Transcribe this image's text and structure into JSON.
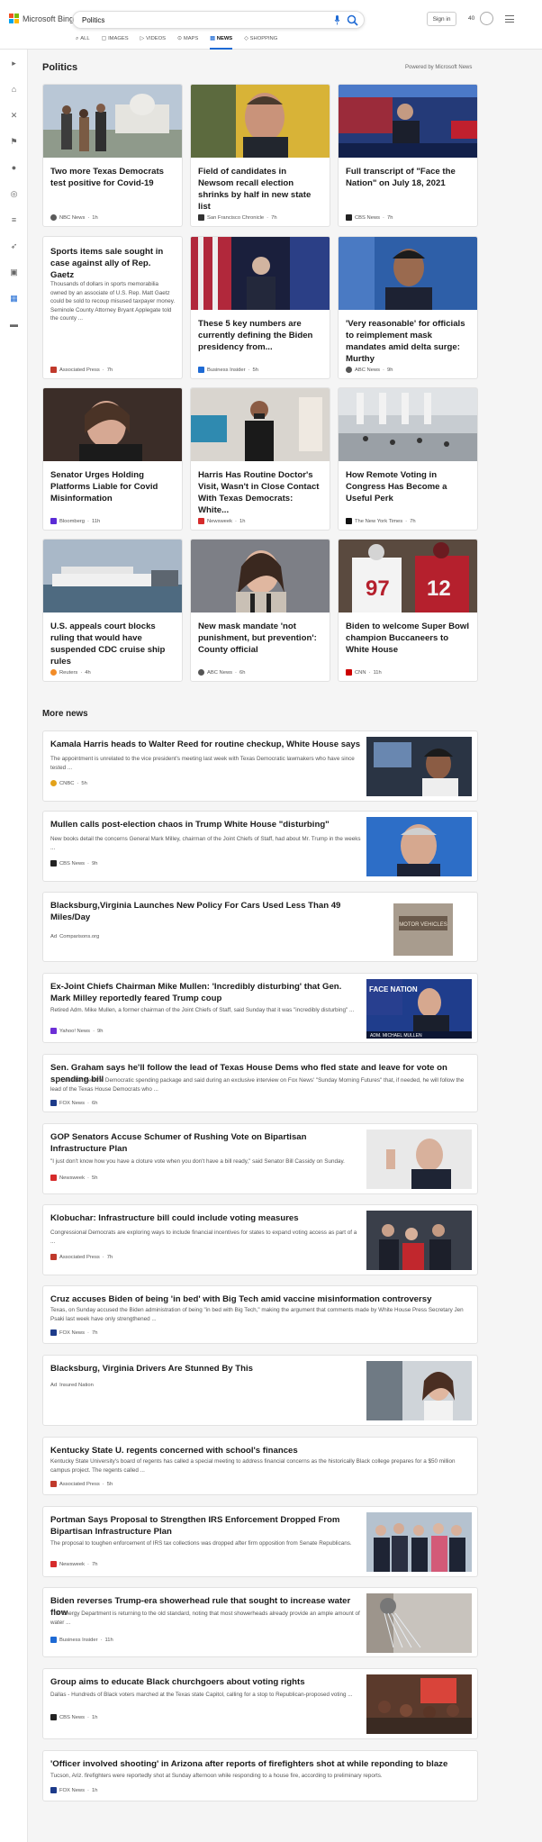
{
  "header": {
    "logo_text": "Microsoft Bing",
    "search_value": "Politics",
    "sign_in": "Sign in",
    "points": "40",
    "tabs": [
      {
        "label": "ALL",
        "icon": "search-icon"
      },
      {
        "label": "IMAGES",
        "icon": "image-icon"
      },
      {
        "label": "VIDEOS",
        "icon": "video-icon"
      },
      {
        "label": "MAPS",
        "icon": "map-pin-icon"
      },
      {
        "label": "NEWS",
        "icon": "news-icon",
        "active": true
      },
      {
        "label": "SHOPPING",
        "icon": "tag-icon"
      }
    ]
  },
  "section": {
    "title": "Politics",
    "powered": "Powered by Microsoft News"
  },
  "colors": {
    "accent": "#1e6ad4"
  },
  "cards": [
    {
      "title": "Two more Texas Democrats test positive for Covid-19",
      "source": "NBC News",
      "time": "1h",
      "badge": "#5a5a5a"
    },
    {
      "title": "Field of candidates in Newsom recall election shrinks by half in new state list",
      "source": "San Francisco Chronicle",
      "time": "7h",
      "badge": "#333333"
    },
    {
      "title": "Full transcript of \"Face the Nation\" on July 18, 2021",
      "source": "CBS News",
      "time": "7h",
      "badge": "#222222"
    },
    {
      "title": "Sports items sale sought in case against ally of Rep. Gaetz",
      "snippet": "Thousands of dollars in sports memorabilia owned by an associate of U.S. Rep. Matt Gaetz could be sold to recoup misused taxpayer money. Seminole County Attorney Bryant Applegate told the county ...",
      "source": "Associated Press",
      "time": "7h",
      "badge": "#c0392b"
    },
    {
      "title": "These 5 key numbers are currently defining the Biden presidency from...",
      "source": "Business Insider",
      "time": "5h",
      "badge": "#1e6ad4"
    },
    {
      "title": "'Very reasonable' for officials to reimplement mask mandates amid delta surge: Murthy",
      "source": "ABC News",
      "time": "9h",
      "badge": "#555555"
    },
    {
      "title": "Senator Urges Holding Platforms Liable for Covid Misinformation",
      "source": "Bloomberg",
      "time": "11h",
      "badge": "#5b2bd6"
    },
    {
      "title": "Harris Has Routine Doctor's Visit, Wasn't in Close Contact With Texas Democrats: White...",
      "source": "Newsweek",
      "time": "1h",
      "badge": "#d62b2b"
    },
    {
      "title": "How Remote Voting in Congress Has Become a Useful Perk",
      "source": "The New York Times",
      "time": "7h",
      "badge": "#111111"
    },
    {
      "title": "U.S. appeals court blocks ruling that would have suspended CDC cruise ship rules",
      "source": "Reuters",
      "time": "4h",
      "badge": "#f28c28"
    },
    {
      "title": "New mask mandate 'not punishment, but prevention': County official",
      "source": "ABC News",
      "time": "6h",
      "badge": "#555555"
    },
    {
      "title": "Biden to welcome Super Bowl champion Buccaneers to White House",
      "source": "CNN",
      "time": "11h",
      "badge": "#cc0000"
    }
  ],
  "more_news": {
    "title": "More news",
    "items": [
      {
        "title": "Kamala Harris heads to Walter Reed for routine checkup, White House says",
        "snippet": "The appointment is unrelated to the vice president's meeting last week with Texas Democratic lawmakers who have since tested ...",
        "source": "CNBC",
        "time": "5h",
        "badge": "#e3a21a"
      },
      {
        "title": "Mullen calls post-election chaos in Trump White House \"disturbing\"",
        "snippet": "New books detail the concerns General Mark Milley, chairman of the Joint Chiefs of Staff, had about Mr. Trump in the weeks ...",
        "source": "CBS News",
        "time": "9h",
        "badge": "#222222"
      },
      {
        "title": "Blacksburg,Virginia Launches New Policy For Cars Used Less Than 49 Miles/Day",
        "ad": "Ad",
        "source": "Comparisons.org"
      },
      {
        "title": "Ex-Joint Chiefs Chairman Mike Mullen: 'Incredibly disturbing' that Gen. Mark Milley reportedly feared Trump coup",
        "snippet": "Retired Adm. Mike Mullen, a former chairman of the Joint Chiefs of Staff, said Sunday that it was \"incredibly disturbing\" ...",
        "source": "Yahoo! News",
        "time": "9h",
        "badge": "#6d2fd6",
        "tv_text": "FACE NATION",
        "tv_bar": "ADM. MICHAEL MULLEN"
      },
      {
        "title": "Sen. Graham says he'll follow the lead of Texas House Dems who fled state and leave for vote on spending bill",
        "snippet": "S.C., condemned the Democratic spending package and said during an exclusive interview on Fox News' \"Sunday Morning Futures\" that, if needed, he will follow the lead of the Texas House Democrats who ...",
        "source": "FOX News",
        "time": "6h",
        "badge": "#1d3b8a"
      },
      {
        "title": "GOP Senators Accuse Schumer of Rushing Vote on Bipartisan Infrastructure Plan",
        "snippet": "\"I just don't know how you have a cloture vote when you don't have a bill ready,\" said Senator Bill Cassidy on Sunday.",
        "source": "Newsweek",
        "time": "5h",
        "badge": "#d62b2b"
      },
      {
        "title": "Klobuchar: Infrastructure bill could include voting measures",
        "snippet": "Congressional Democrats are exploring ways to include financial incentives for states to expand voting access as part of a ...",
        "source": "Associated Press",
        "time": "7h",
        "badge": "#c0392b"
      },
      {
        "title": "Cruz accuses Biden of being 'in bed' with Big Tech amid vaccine misinformation controversy",
        "snippet": "Texas, on Sunday accused the Biden administration of being \"in bed with Big Tech,\" making the argument that comments made by White House Press Secretary Jen Psaki last week have only strengthened ...",
        "source": "FOX News",
        "time": "7h",
        "badge": "#1d3b8a"
      },
      {
        "title": "Blacksburg, Virginia Drivers Are Stunned By This",
        "ad": "Ad",
        "source": "Insured Nation"
      },
      {
        "title": "Kentucky State U. regents concerned with school's finances",
        "snippet": "Kentucky State University's board of regents has called a special meeting to address financial concerns as the historically Black college prepares for a $50 million campus project. The regents called ...",
        "source": "Associated Press",
        "time": "5h",
        "badge": "#c0392b"
      },
      {
        "title": "Portman Says Proposal to Strengthen IRS Enforcement Dropped From Bipartisan Infrastructure Plan",
        "snippet": "The proposal to toughen enforcement of IRS tax collections was dropped after firm opposition from Senate Republicans.",
        "source": "Newsweek",
        "time": "7h",
        "badge": "#d62b2b"
      },
      {
        "title": "Biden reverses Trump-era showerhead rule that sought to increase water flow",
        "snippet": "The Energy Department is returning to the old standard, noting that most showerheads already provide an ample amount of water ...",
        "source": "Business Insider",
        "time": "11h",
        "badge": "#1e6ad4"
      },
      {
        "title": "Group aims to educate Black churchgoers about voting rights",
        "snippet": "Dallas - Hundreds of Black voters marched at the Texas state Capitol, calling for a stop to Republican-proposed voting ...",
        "source": "CBS News",
        "time": "1h",
        "badge": "#222222"
      },
      {
        "title": "'Officer involved shooting' in Arizona after reports of firefighters shot at while reponding to blaze",
        "snippet": "Tucson, Ariz. firefighters were reportedly shot at Sunday afternoon while responding to a house fire, according to preliminary reports.",
        "source": "FOX News",
        "time": "1h",
        "badge": "#1d3b8a"
      }
    ]
  }
}
